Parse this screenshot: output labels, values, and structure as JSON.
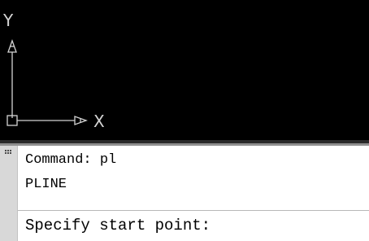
{
  "canvas": {
    "background": "#000000",
    "ucs_icon": {
      "y_label": "Y",
      "x_label": "X",
      "color": "#d4d4d4"
    }
  },
  "command_window": {
    "history": [
      "Command: pl",
      "PLINE"
    ],
    "prompt": "Specify start point:",
    "grip_icon": "drag-grip-icon"
  }
}
